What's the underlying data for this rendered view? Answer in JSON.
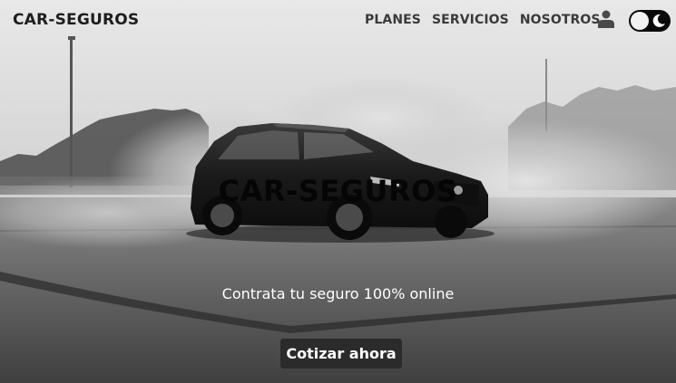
{
  "navbar": {
    "brand": "CAR-SEGUROS",
    "links": [
      {
        "label": "PLANES"
      },
      {
        "label": "SERVICIOS"
      },
      {
        "label": "NOSOTROS"
      }
    ],
    "icons": {
      "user": "user-icon",
      "theme": "moon-icon"
    },
    "theme_toggle": {
      "state": "light"
    }
  },
  "hero": {
    "title": "CAR-SEGUROS",
    "subtitle": "Contrata tu seguro 100% online",
    "cta_label": "Cotizar ahora"
  },
  "colors": {
    "title_text": "#050505",
    "nav_text": "#3a3a3a",
    "cta_background": "#2b2b2b",
    "cta_text": "#ffffff",
    "toggle_background": "#0a0a0a"
  }
}
